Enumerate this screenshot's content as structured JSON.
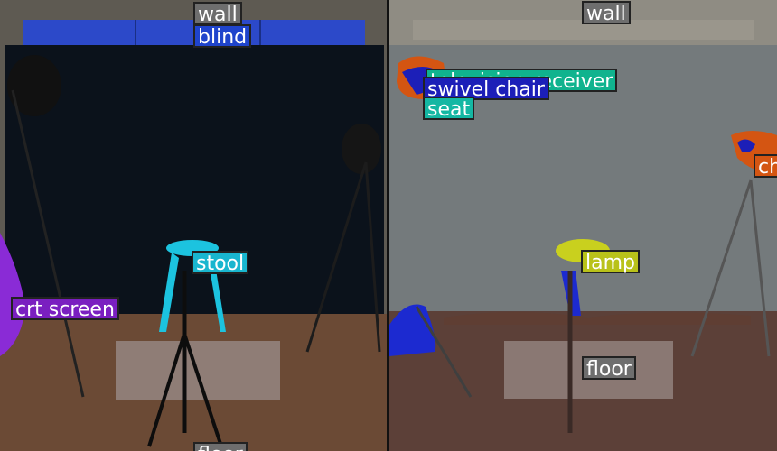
{
  "colors": {
    "wall": "#6e6e6e",
    "blind": "#1f44cc",
    "stool": "#19b6cf",
    "crt_screen": "#7a1fc0",
    "floor": "#6e6e6e",
    "television_receiver": "#10b38e",
    "swivel_chair": "#1c1fb8",
    "seat": "#14b7a3",
    "lamp": "#b9c21a",
    "chair": "#d45512"
  },
  "left_panel": {
    "labels": {
      "wall": "wall",
      "blind": "blind",
      "stool": "stool",
      "crt_screen": "crt screen",
      "floor": "floor"
    }
  },
  "right_panel": {
    "labels": {
      "wall": "wall",
      "television_receiver": "television receiver",
      "swivel_chair": "swivel chair",
      "seat": "seat",
      "lamp": "lamp",
      "chair": "chair",
      "floor": "floor"
    }
  }
}
